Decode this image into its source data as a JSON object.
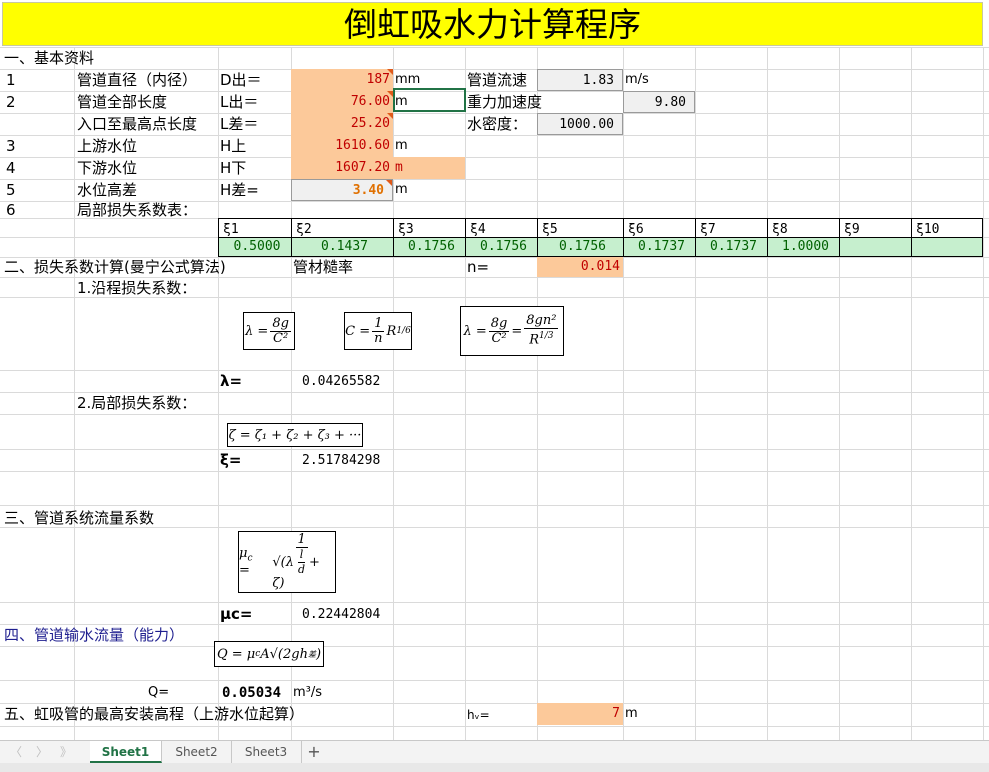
{
  "title": "倒虹吸水力计算程序",
  "sec1": {
    "header": "一、基本资料",
    "rows": [
      {
        "num": "1",
        "label": "管道直径（内径）",
        "sym": "D出＝",
        "value": "187",
        "unit": "mm"
      },
      {
        "num": "2",
        "label": "管道全部长度",
        "sym": "L出＝",
        "value": "76.00",
        "unit": "m"
      },
      {
        "num": "",
        "label": "入口至最高点长度",
        "sym": "L差＝",
        "value": "25.20",
        "unit": ""
      },
      {
        "num": "3",
        "label": "上游水位",
        "sym": "H上",
        "value": "1610.60",
        "unit": "m"
      },
      {
        "num": "4",
        "label": "下游水位",
        "sym": "H下",
        "value": "1607.20",
        "unit": "m"
      },
      {
        "num": "5",
        "label": "水位高差",
        "sym": "H差=",
        "value": "3.40",
        "unit": "m"
      },
      {
        "num": "6",
        "label": "局部损失系数表："
      }
    ],
    "flow_label": "管道流速",
    "flow_value": "1.83",
    "flow_unit": "m/s",
    "gravity_label": "重力加速度",
    "gravity_value": "9.80",
    "density_label": "水密度：",
    "density_value": "1000.00"
  },
  "xi_table": {
    "headers": [
      "ξ1",
      "ξ2",
      "ξ3",
      "ξ4",
      "ξ5",
      "ξ6",
      "ξ7",
      "ξ8",
      "ξ9",
      "ξ10"
    ],
    "values": [
      "0.5000",
      "0.1437",
      "0.1756",
      "0.1756",
      "0.1756",
      "0.1737",
      "0.1737",
      "1.0000",
      "",
      ""
    ]
  },
  "sec2": {
    "header": "二、损失系数计算(曼宁公式算法)",
    "rough_label": "管材糙率",
    "n_label": "n=",
    "n_value": "0.014",
    "sub1": "1.沿程损失系数：",
    "lambda_label": "λ=",
    "lambda_value": "0.04265582",
    "sub2": "2.局部损失系数：",
    "xi_label": "ξ=",
    "xi_value": "2.51784298"
  },
  "sec3": {
    "header": "三、管道系统流量系数",
    "mu_label": "μc=",
    "mu_value": "0.22442804"
  },
  "sec4": {
    "header": "四、管道输水流量（能力）",
    "q_label": "Q=",
    "q_value": "0.05034",
    "q_unit": "m³/s"
  },
  "sec5": {
    "header": "五、虹吸管的最高安装高程（上游水位起算）",
    "hv_label": "hᵥ=",
    "hv_value": "7",
    "hv_unit": "m"
  },
  "tabs": [
    "Sheet1",
    "Sheet2",
    "Sheet3"
  ],
  "add_tab": "+",
  "nav": [
    "〈",
    "〉",
    "》"
  ]
}
